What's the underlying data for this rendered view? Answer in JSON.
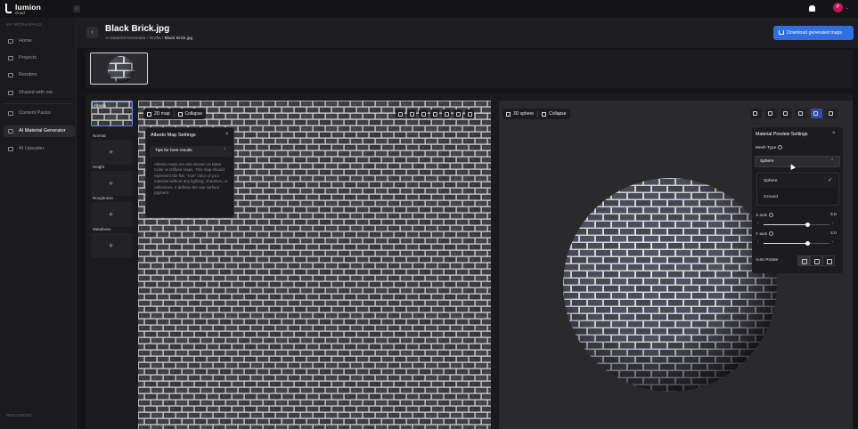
{
  "app": {
    "logo_text": "lumion",
    "logo_sub": "cloud",
    "avatar_initial": "P"
  },
  "sidebar": {
    "workspace_label": "MY WORKSPACE",
    "items": [
      {
        "label": "Home",
        "icon": "home-icon"
      },
      {
        "label": "Projects",
        "icon": "folder-icon"
      },
      {
        "label": "Renders",
        "icon": "file-icon"
      },
      {
        "label": "Shared with me",
        "icon": "share-icon"
      },
      {
        "label": "Content Packs",
        "icon": "package-icon"
      },
      {
        "label": "AI Material Generator",
        "icon": "sparkle-icon"
      },
      {
        "label": "AI Upscaler",
        "icon": "upscale-icon"
      }
    ],
    "resources_label": "RESOURCES"
  },
  "header": {
    "title": "Black Brick.jpg",
    "breadcrumb": [
      "AI Material Generator",
      "Drafts"
    ],
    "breadcrumb_current": "Black Brick.jpg",
    "breadcrumb_sep": "/",
    "download_label": "Download generated maps"
  },
  "channels": [
    {
      "label": "Albedo"
    },
    {
      "label": "Normal"
    },
    {
      "label": "Height"
    },
    {
      "label": "Roughness"
    },
    {
      "label": "Metalness"
    }
  ],
  "map_viewer": {
    "mode_label": "2D map",
    "collapse_label": "Collapse"
  },
  "albedo_popover": {
    "title": "Albedo Map Settings",
    "tips_label": "Tips for best results",
    "body": "Albedo maps are also known as Base Color or Diffuse maps. This map should represent the flat, \"true\" color of your material without any lighting, shadows, or reflections. It defines the raw surface pigment."
  },
  "preview": {
    "mode_label": "3D sphere",
    "collapse_label": "Collapse"
  },
  "material_panel": {
    "title": "Material Preview Settings",
    "mesh_type_label": "Mesh Type",
    "mesh_type_value": "Sphere",
    "options": [
      "Sphere",
      "Ground"
    ],
    "x_axis_label": "X axis",
    "x_axis_value": "3.0",
    "y_axis_label": "Y axis",
    "y_axis_value": "3.0",
    "auto_rotate_label": "Auto Rotate"
  },
  "colors": {
    "accent": "#2f6fe4",
    "avatar": "#c2185b",
    "brick": "#4a4b57",
    "mortar": "#d6d6d6"
  }
}
